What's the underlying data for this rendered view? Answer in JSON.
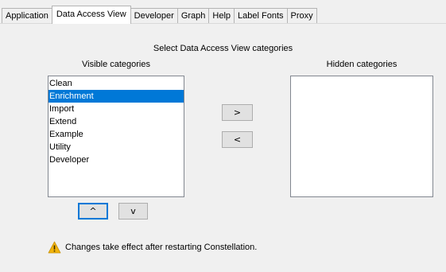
{
  "tabs": [
    {
      "label": "Application",
      "active": false
    },
    {
      "label": "Data Access View",
      "active": true
    },
    {
      "label": "Developer",
      "active": false
    },
    {
      "label": "Graph",
      "active": false
    },
    {
      "label": "Help",
      "active": false
    },
    {
      "label": "Label Fonts",
      "active": false
    },
    {
      "label": "Proxy",
      "active": false
    }
  ],
  "panel": {
    "title": "Select Data Access View categories",
    "visible_label": "Visible categories",
    "hidden_label": "Hidden categories",
    "visible_items": [
      {
        "label": "Clean",
        "selected": false
      },
      {
        "label": "Enrichment",
        "selected": true
      },
      {
        "label": "Import",
        "selected": false
      },
      {
        "label": "Extend",
        "selected": false
      },
      {
        "label": "Example",
        "selected": false
      },
      {
        "label": "Utility",
        "selected": false
      },
      {
        "label": "Developer",
        "selected": false
      }
    ],
    "hidden_items": [],
    "move_right_label": ">",
    "move_left_label": "<",
    "up_label": "^",
    "down_label": "v",
    "notice": "Changes take effect after restarting Constellation.",
    "notice_icon": "warning-icon"
  },
  "colors": {
    "selection": "#0078d7",
    "warning": "#f2b40b"
  }
}
